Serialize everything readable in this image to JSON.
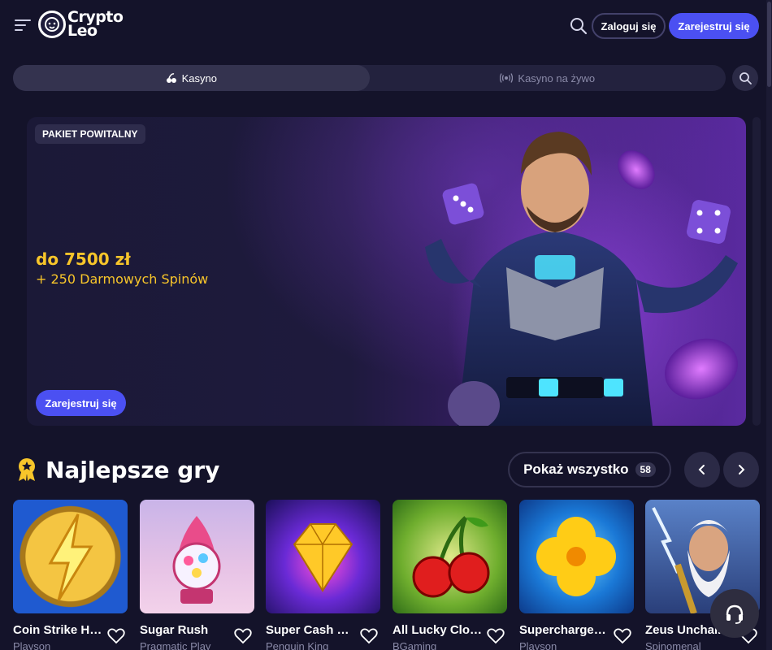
{
  "header": {
    "logo_line1": "Crypto",
    "logo_line2": "Leo",
    "login_label": "Zaloguj się",
    "register_label": "Zarejestruj się"
  },
  "tabs": [
    {
      "label": "Kasyno",
      "icon": "casino-icon",
      "active": true
    },
    {
      "label": "Kasyno na żywo",
      "icon": "live-broadcast-icon",
      "active": false
    }
  ],
  "banner": {
    "badge": "PAKIET POWITALNY",
    "amount": "do 7500 zł",
    "subtitle": "+ 250 Darmowych Spinów",
    "cta": "Zarejestruj się"
  },
  "section": {
    "title": "Najlepsze gry",
    "show_all_label": "Pokaż wszystko",
    "show_all_count": "58"
  },
  "games": [
    {
      "name": "Coin Strike Ho...",
      "provider": "Playson"
    },
    {
      "name": "Sugar Rush",
      "provider": "Pragmatic Play"
    },
    {
      "name": "Super Cash Bo...",
      "provider": "Penguin King"
    },
    {
      "name": "All Lucky Clov...",
      "provider": "BGaming"
    },
    {
      "name": "Supercharged...",
      "provider": "Playson"
    },
    {
      "name": "Zeus Unchai...",
      "provider": "Spinomenal"
    }
  ],
  "colors": {
    "accent": "#4b50f2",
    "gold": "#f7c52a",
    "background": "#14132a"
  }
}
